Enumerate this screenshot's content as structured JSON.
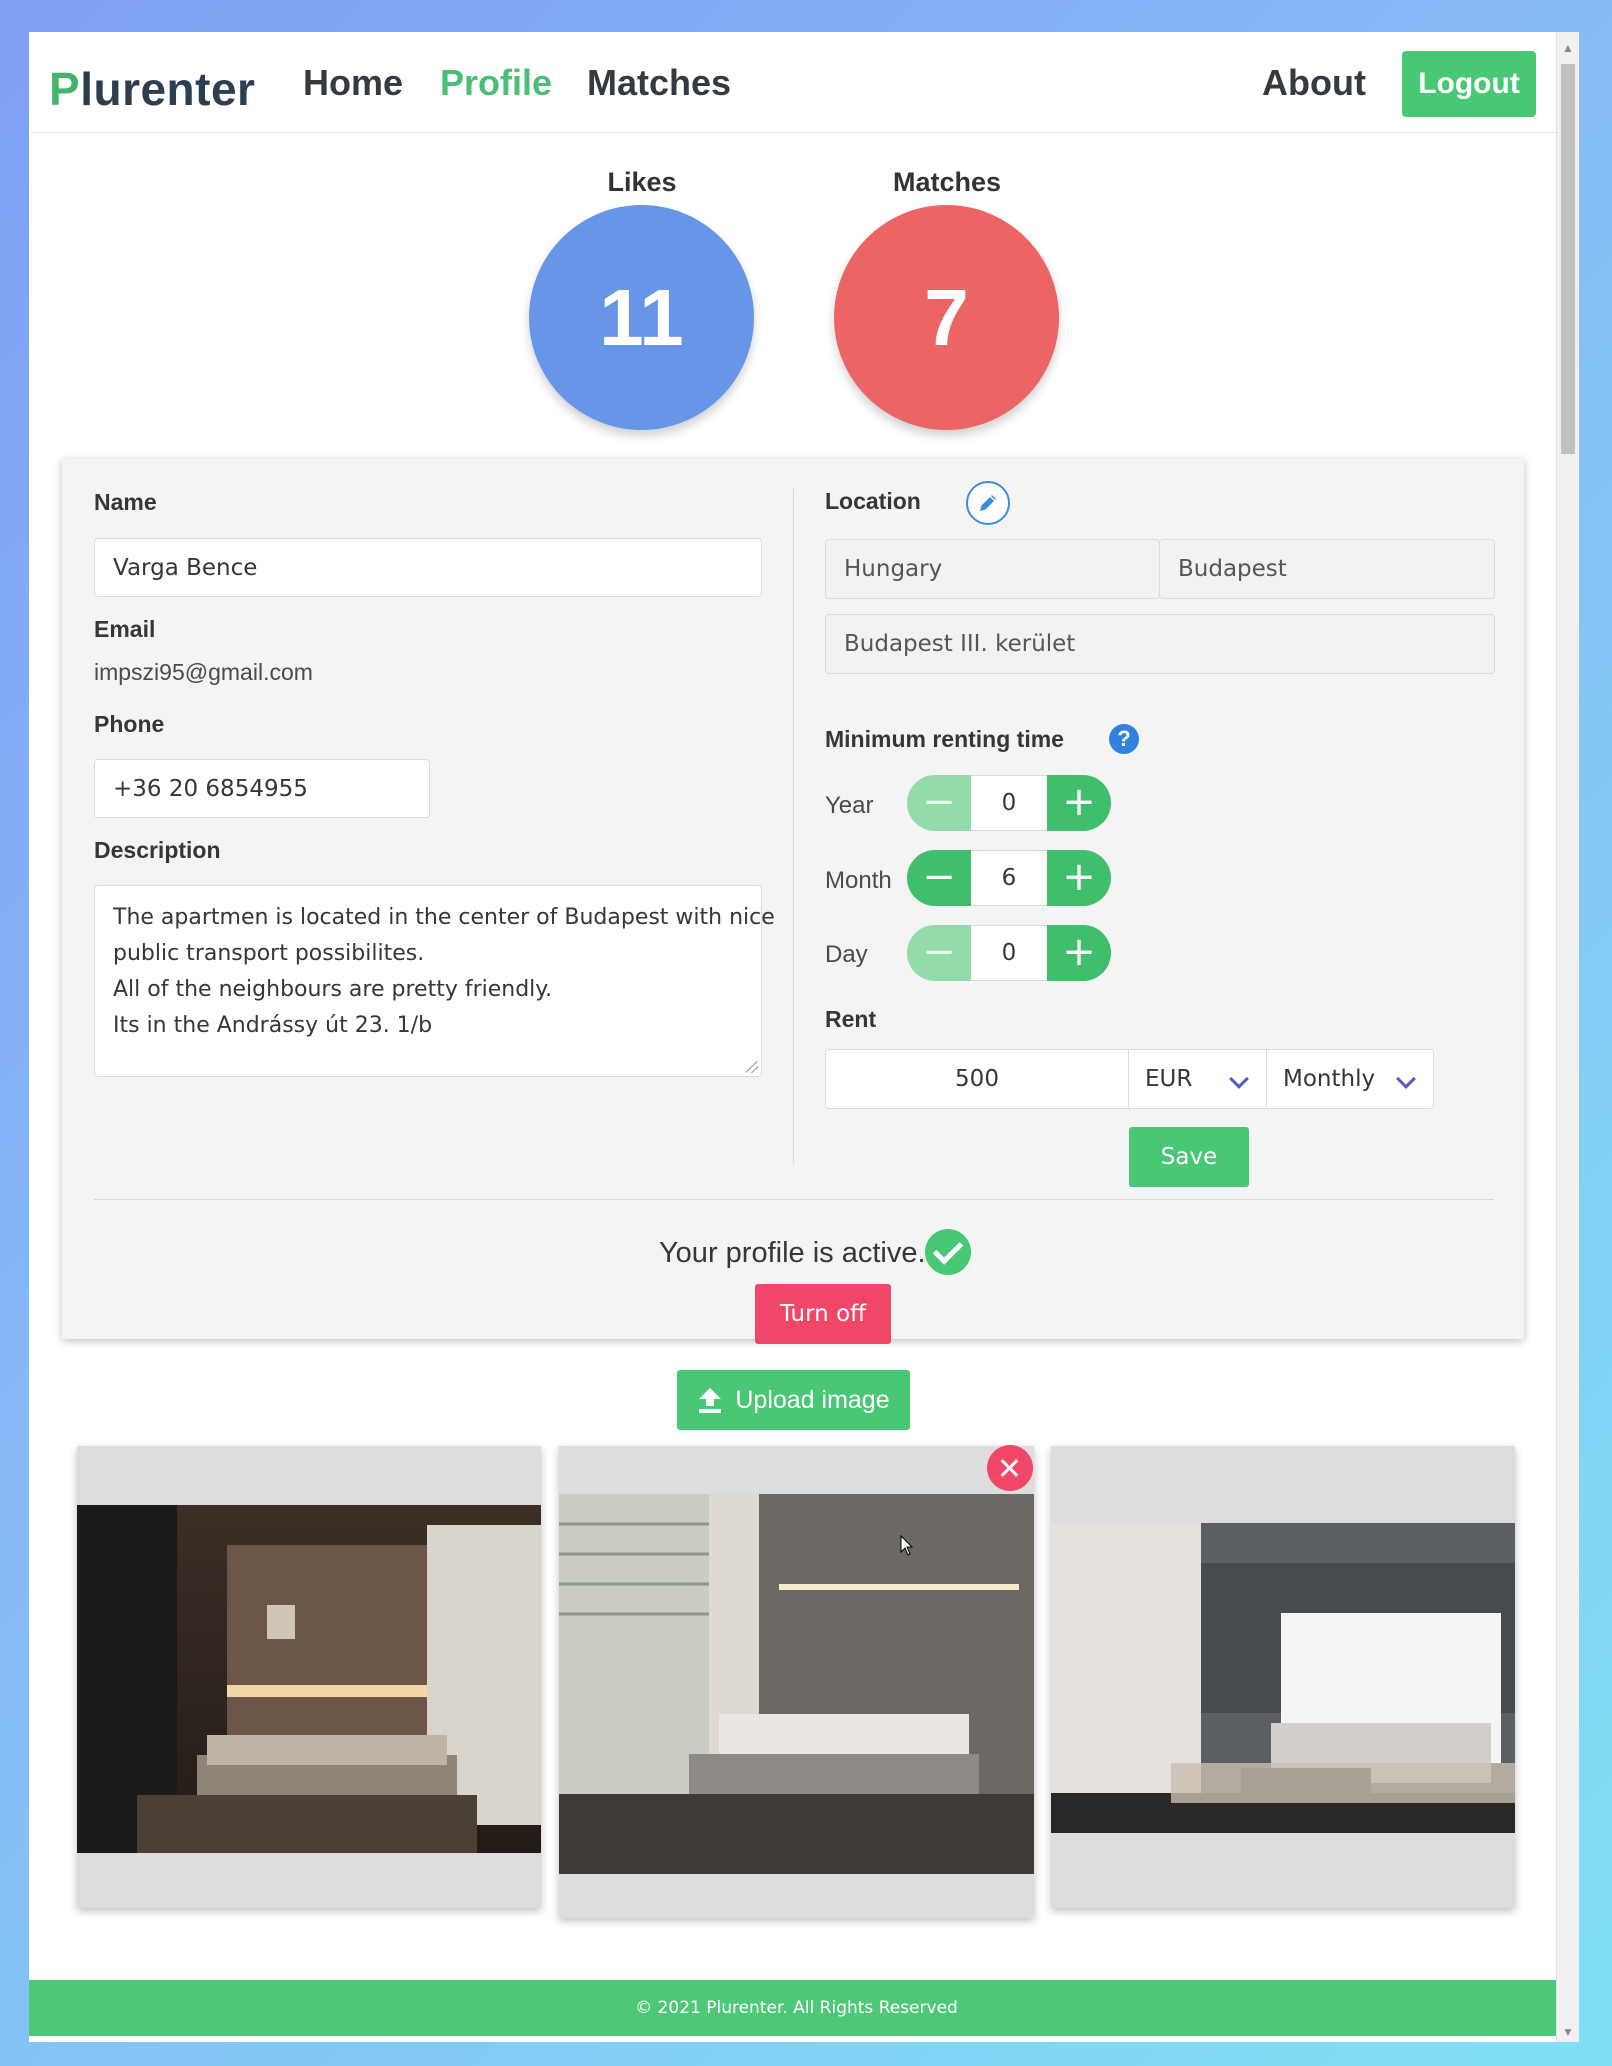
{
  "nav": {
    "brand_first": "P",
    "brand_rest": "lurenter",
    "links": [
      "Home",
      "Profile",
      "Matches"
    ],
    "about": "About",
    "logout": "Logout"
  },
  "stats": {
    "likes_label": "Likes",
    "likes_value": "11",
    "matches_label": "Matches",
    "matches_value": "7"
  },
  "profile": {
    "name_label": "Name",
    "name_value": "Varga Bence",
    "email_label": "Email",
    "email_value": "impszi95@gmail.com",
    "phone_label": "Phone",
    "phone_value": "+36 20 6854955",
    "description_label": "Description",
    "description_lines": [
      "The apartmen is located in the center of Budapest with nice",
      "public transport possibilites.",
      "All of the neighbours are pretty friendly.",
      "Its in the Andrássy út 23. 1/b"
    ]
  },
  "location": {
    "label": "Location",
    "country": "Hungary",
    "city": "Budapest",
    "district": "Budapest III. kerület"
  },
  "renting": {
    "label": "Minimum renting time",
    "help": "?",
    "year_label": "Year",
    "year_value": "0",
    "month_label": "Month",
    "month_value": "6",
    "day_label": "Day",
    "day_value": "0",
    "minus": "−",
    "plus": "+"
  },
  "rent": {
    "label": "Rent",
    "amount": "500",
    "currency": "EUR",
    "period": "Monthly",
    "save": "Save"
  },
  "status": {
    "text": "Your profile is active.",
    "turn_off": "Turn off"
  },
  "upload": {
    "label": "Upload image"
  },
  "footer": {
    "text": "© 2021 Plurenter. All Rights Reserved"
  },
  "colors": {
    "brand_green": "#48c774",
    "likes_blue": "#6796e8",
    "matches_red": "#ec6565",
    "danger": "#f14668"
  }
}
